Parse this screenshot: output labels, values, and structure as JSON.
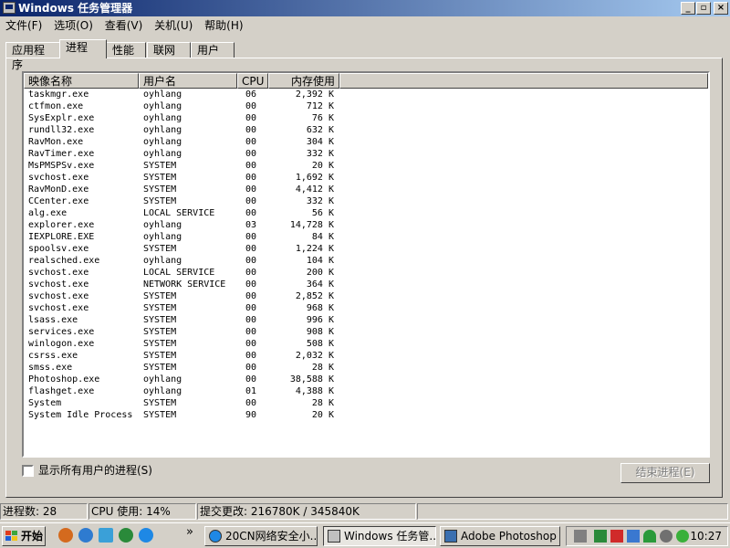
{
  "window": {
    "title": "Windows 任务管理器"
  },
  "titlebar_buttons": {
    "minimize": "_",
    "maximize": "▫",
    "close": "×"
  },
  "menu": [
    "文件(F)",
    "选项(O)",
    "查看(V)",
    "关机(U)",
    "帮助(H)"
  ],
  "tabs": [
    "应用程序",
    "进程",
    "性能",
    "联网",
    "用户"
  ],
  "active_tab": "进程",
  "columns": [
    "映像名称",
    "用户名",
    "CPU",
    "内存使用"
  ],
  "processes": [
    {
      "name": "taskmgr.exe",
      "user": "oyhlang",
      "cpu": "06",
      "mem": "2,392 K"
    },
    {
      "name": "ctfmon.exe",
      "user": "oyhlang",
      "cpu": "00",
      "mem": "712 K"
    },
    {
      "name": "SysExplr.exe",
      "user": "oyhlang",
      "cpu": "00",
      "mem": "76 K"
    },
    {
      "name": "rundll32.exe",
      "user": "oyhlang",
      "cpu": "00",
      "mem": "632 K"
    },
    {
      "name": "RavMon.exe",
      "user": "oyhlang",
      "cpu": "00",
      "mem": "304 K"
    },
    {
      "name": "RavTimer.exe",
      "user": "oyhlang",
      "cpu": "00",
      "mem": "332 K"
    },
    {
      "name": "MsPMSPSv.exe",
      "user": "SYSTEM",
      "cpu": "00",
      "mem": "20 K"
    },
    {
      "name": "svchost.exe",
      "user": "SYSTEM",
      "cpu": "00",
      "mem": "1,692 K"
    },
    {
      "name": "RavMonD.exe",
      "user": "SYSTEM",
      "cpu": "00",
      "mem": "4,412 K"
    },
    {
      "name": "CCenter.exe",
      "user": "SYSTEM",
      "cpu": "00",
      "mem": "332 K"
    },
    {
      "name": "alg.exe",
      "user": "LOCAL SERVICE",
      "cpu": "00",
      "mem": "56 K"
    },
    {
      "name": "explorer.exe",
      "user": "oyhlang",
      "cpu": "03",
      "mem": "14,728 K"
    },
    {
      "name": "IEXPLORE.EXE",
      "user": "oyhlang",
      "cpu": "00",
      "mem": "84 K"
    },
    {
      "name": "spoolsv.exe",
      "user": "SYSTEM",
      "cpu": "00",
      "mem": "1,224 K"
    },
    {
      "name": "realsched.exe",
      "user": "oyhlang",
      "cpu": "00",
      "mem": "104 K"
    },
    {
      "name": "svchost.exe",
      "user": "LOCAL SERVICE",
      "cpu": "00",
      "mem": "200 K"
    },
    {
      "name": "svchost.exe",
      "user": "NETWORK SERVICE",
      "cpu": "00",
      "mem": "364 K"
    },
    {
      "name": "svchost.exe",
      "user": "SYSTEM",
      "cpu": "00",
      "mem": "2,852 K"
    },
    {
      "name": "svchost.exe",
      "user": "SYSTEM",
      "cpu": "00",
      "mem": "968 K"
    },
    {
      "name": "lsass.exe",
      "user": "SYSTEM",
      "cpu": "00",
      "mem": "996 K"
    },
    {
      "name": "services.exe",
      "user": "SYSTEM",
      "cpu": "00",
      "mem": "908 K"
    },
    {
      "name": "winlogon.exe",
      "user": "SYSTEM",
      "cpu": "00",
      "mem": "508 K"
    },
    {
      "name": "csrss.exe",
      "user": "SYSTEM",
      "cpu": "00",
      "mem": "2,032 K"
    },
    {
      "name": "smss.exe",
      "user": "SYSTEM",
      "cpu": "00",
      "mem": "28 K"
    },
    {
      "name": "Photoshop.exe",
      "user": "oyhlang",
      "cpu": "00",
      "mem": "38,588 K"
    },
    {
      "name": "flashget.exe",
      "user": "oyhlang",
      "cpu": "01",
      "mem": "4,388 K"
    },
    {
      "name": "System",
      "user": "SYSTEM",
      "cpu": "00",
      "mem": "28 K"
    },
    {
      "name": "System Idle Process",
      "user": "SYSTEM",
      "cpu": "90",
      "mem": "20 K"
    }
  ],
  "show_all_users": {
    "label": "显示所有用户的进程(S)",
    "checked": false
  },
  "end_process_button": "结束进程(E)",
  "status": {
    "processes": "进程数: 28",
    "cpu": "CPU 使用: 14%",
    "commit": "提交更改: 216780K / 345840K"
  },
  "taskbar": {
    "start_label": "开始",
    "quicklaunch_chevron": "»",
    "tasks": [
      {
        "label": "20CN网络安全小...",
        "icon": "ie-icon",
        "active": false
      },
      {
        "label": "Windows 任务管...",
        "icon": "taskmgr-icon",
        "active": true
      },
      {
        "label": "Adobe Photoshop",
        "icon": "photoshop-icon",
        "active": false
      }
    ],
    "clock": "10:27"
  }
}
